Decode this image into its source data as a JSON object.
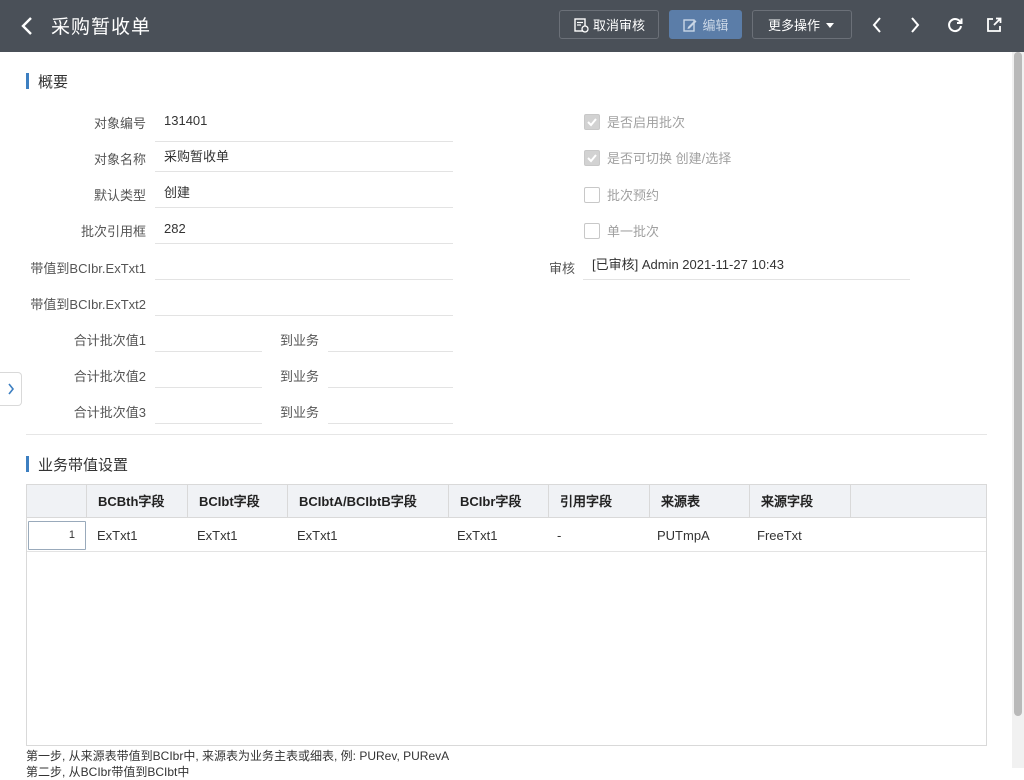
{
  "header": {
    "title": "采购暂收单",
    "cancel_review_label": "取消审核",
    "edit_label": "编辑",
    "more_label": "更多操作"
  },
  "overview": {
    "section_title": "概要",
    "fields": {
      "object_no": {
        "label": "对象编号",
        "value": "131401"
      },
      "object_name": {
        "label": "对象名称",
        "value": "采购暂收单"
      },
      "default_type": {
        "label": "默认类型",
        "value": "创建"
      },
      "batch_ref_box": {
        "label": "批次引用框",
        "value": "282"
      },
      "carry_txt1": {
        "label": "带值到BCIbr.ExTxt1",
        "value": ""
      },
      "carry_txt2": {
        "label": "带值到BCIbr.ExTxt2",
        "value": ""
      },
      "sum1": {
        "label": "合计批次值1",
        "value": "",
        "to_label": "到业务",
        "to_value": ""
      },
      "sum2": {
        "label": "合计批次值2",
        "value": "",
        "to_label": "到业务",
        "to_value": ""
      },
      "sum3": {
        "label": "合计批次值3",
        "value": "",
        "to_label": "到业务",
        "to_value": ""
      }
    },
    "checks": [
      {
        "label": "是否启用批次",
        "checked": true
      },
      {
        "label": "是否可切换 创建/选择",
        "checked": true
      },
      {
        "label": "批次预约",
        "checked": false
      },
      {
        "label": "单一批次",
        "checked": false
      }
    ],
    "review": {
      "label": "审核",
      "value": "[已审核] Admin 2021-11-27 10:43"
    }
  },
  "carry": {
    "section_title": "业务带值设置",
    "columns": [
      "BCBth字段",
      "BCIbt字段",
      "BCIbtA/BCIbtB字段",
      "BCIbr字段",
      "引用字段",
      "来源表",
      "来源字段"
    ],
    "rows": [
      {
        "num": "1",
        "cells": [
          "ExTxt1",
          "ExTxt1",
          "ExTxt1",
          "ExTxt1",
          "-",
          "PUTmpA",
          "FreeTxt"
        ]
      }
    ]
  },
  "notes": [
    "第一步, 从来源表带值到BCIbr中, 来源表为业务主表或细表, 例: PURev, PURevA",
    "第二步, 从BCIbr带值到BCIbt中"
  ]
}
